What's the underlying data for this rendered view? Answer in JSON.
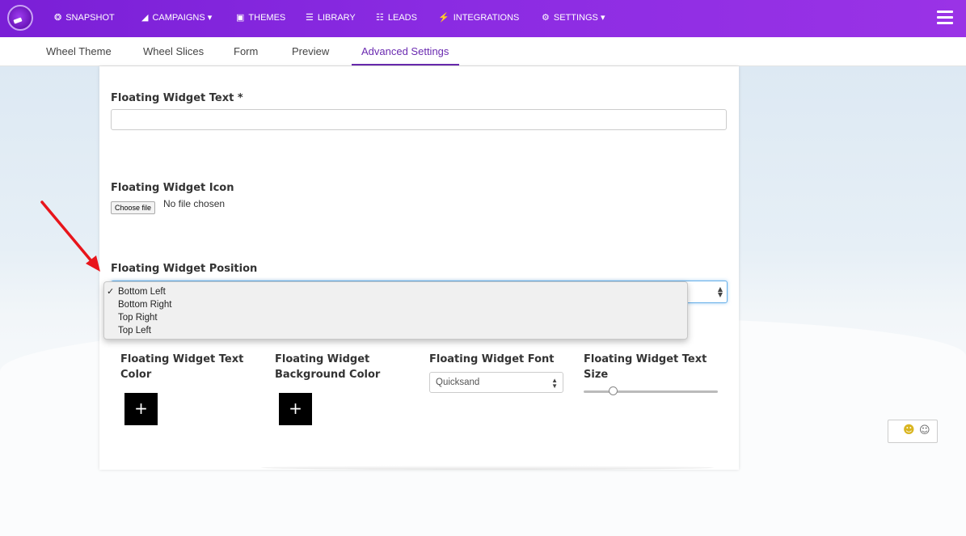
{
  "nav": {
    "items": [
      {
        "label": "SNAPSHOT",
        "icon": "dashboard-icon",
        "glyph": "❂"
      },
      {
        "label": "CAMPAIGNS",
        "icon": "paper-plane-icon",
        "glyph": "◢",
        "caret": "▾"
      },
      {
        "label": "THEMES",
        "icon": "image-icon",
        "glyph": "▣"
      },
      {
        "label": "LIBRARY",
        "icon": "library-icon",
        "glyph": "☰"
      },
      {
        "label": "LEADS",
        "icon": "list-icon",
        "glyph": "☷"
      },
      {
        "label": "INTEGRATIONS",
        "icon": "plug-icon",
        "glyph": "⚡"
      },
      {
        "label": "SETTINGS",
        "icon": "gears-icon",
        "glyph": "⚙",
        "caret": "▾"
      }
    ]
  },
  "tabs": [
    "Wheel Theme",
    "Wheel Slices",
    "Form",
    "Preview",
    "Advanced Settings"
  ],
  "active_tab": "Advanced Settings",
  "form": {
    "widget_text_label": "Floating Widget Text *",
    "widget_text_value": "",
    "widget_icon_label": "Floating Widget Icon",
    "file_button": "Choose file",
    "file_status": "No file chosen",
    "widget_position_label": "Floating Widget Position",
    "position_options": [
      "Bottom Left",
      "Bottom Right",
      "Top Right",
      "Top Left"
    ],
    "position_selected": "Bottom Left",
    "check_glyph": "✓",
    "text_color_label": "Floating Widget Text Color",
    "bg_color_label": "Floating Widget Background Color",
    "font_label": "Floating Widget Font",
    "font_value": "Quicksand",
    "text_size_label": "Floating Widget Text Size",
    "text_size_fraction": 0.22,
    "plus_glyph": "+"
  },
  "colors": {
    "nav_purple": "#8a2be2",
    "active_tab": "#6a2ab0",
    "annotation_arrow": "#e8151b"
  }
}
